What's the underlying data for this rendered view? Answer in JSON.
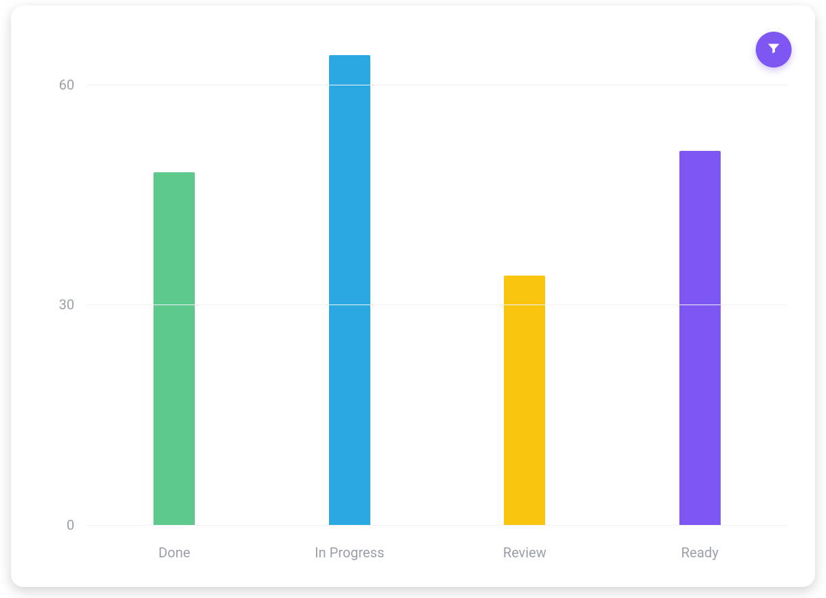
{
  "filter_button": {
    "icon": "filter-icon",
    "accent": "#7e57f2"
  },
  "chart_data": {
    "type": "bar",
    "categories": [
      "Done",
      "In Progress",
      "Review",
      "Ready"
    ],
    "values": [
      48,
      64,
      34,
      51
    ],
    "colors": [
      "#5ec98c",
      "#29a9df",
      "#f9c50f",
      "#7e57f2"
    ],
    "y_ticks": [
      0,
      30,
      60
    ],
    "ylim": [
      0,
      67
    ],
    "title": "",
    "xlabel": "",
    "ylabel": ""
  }
}
